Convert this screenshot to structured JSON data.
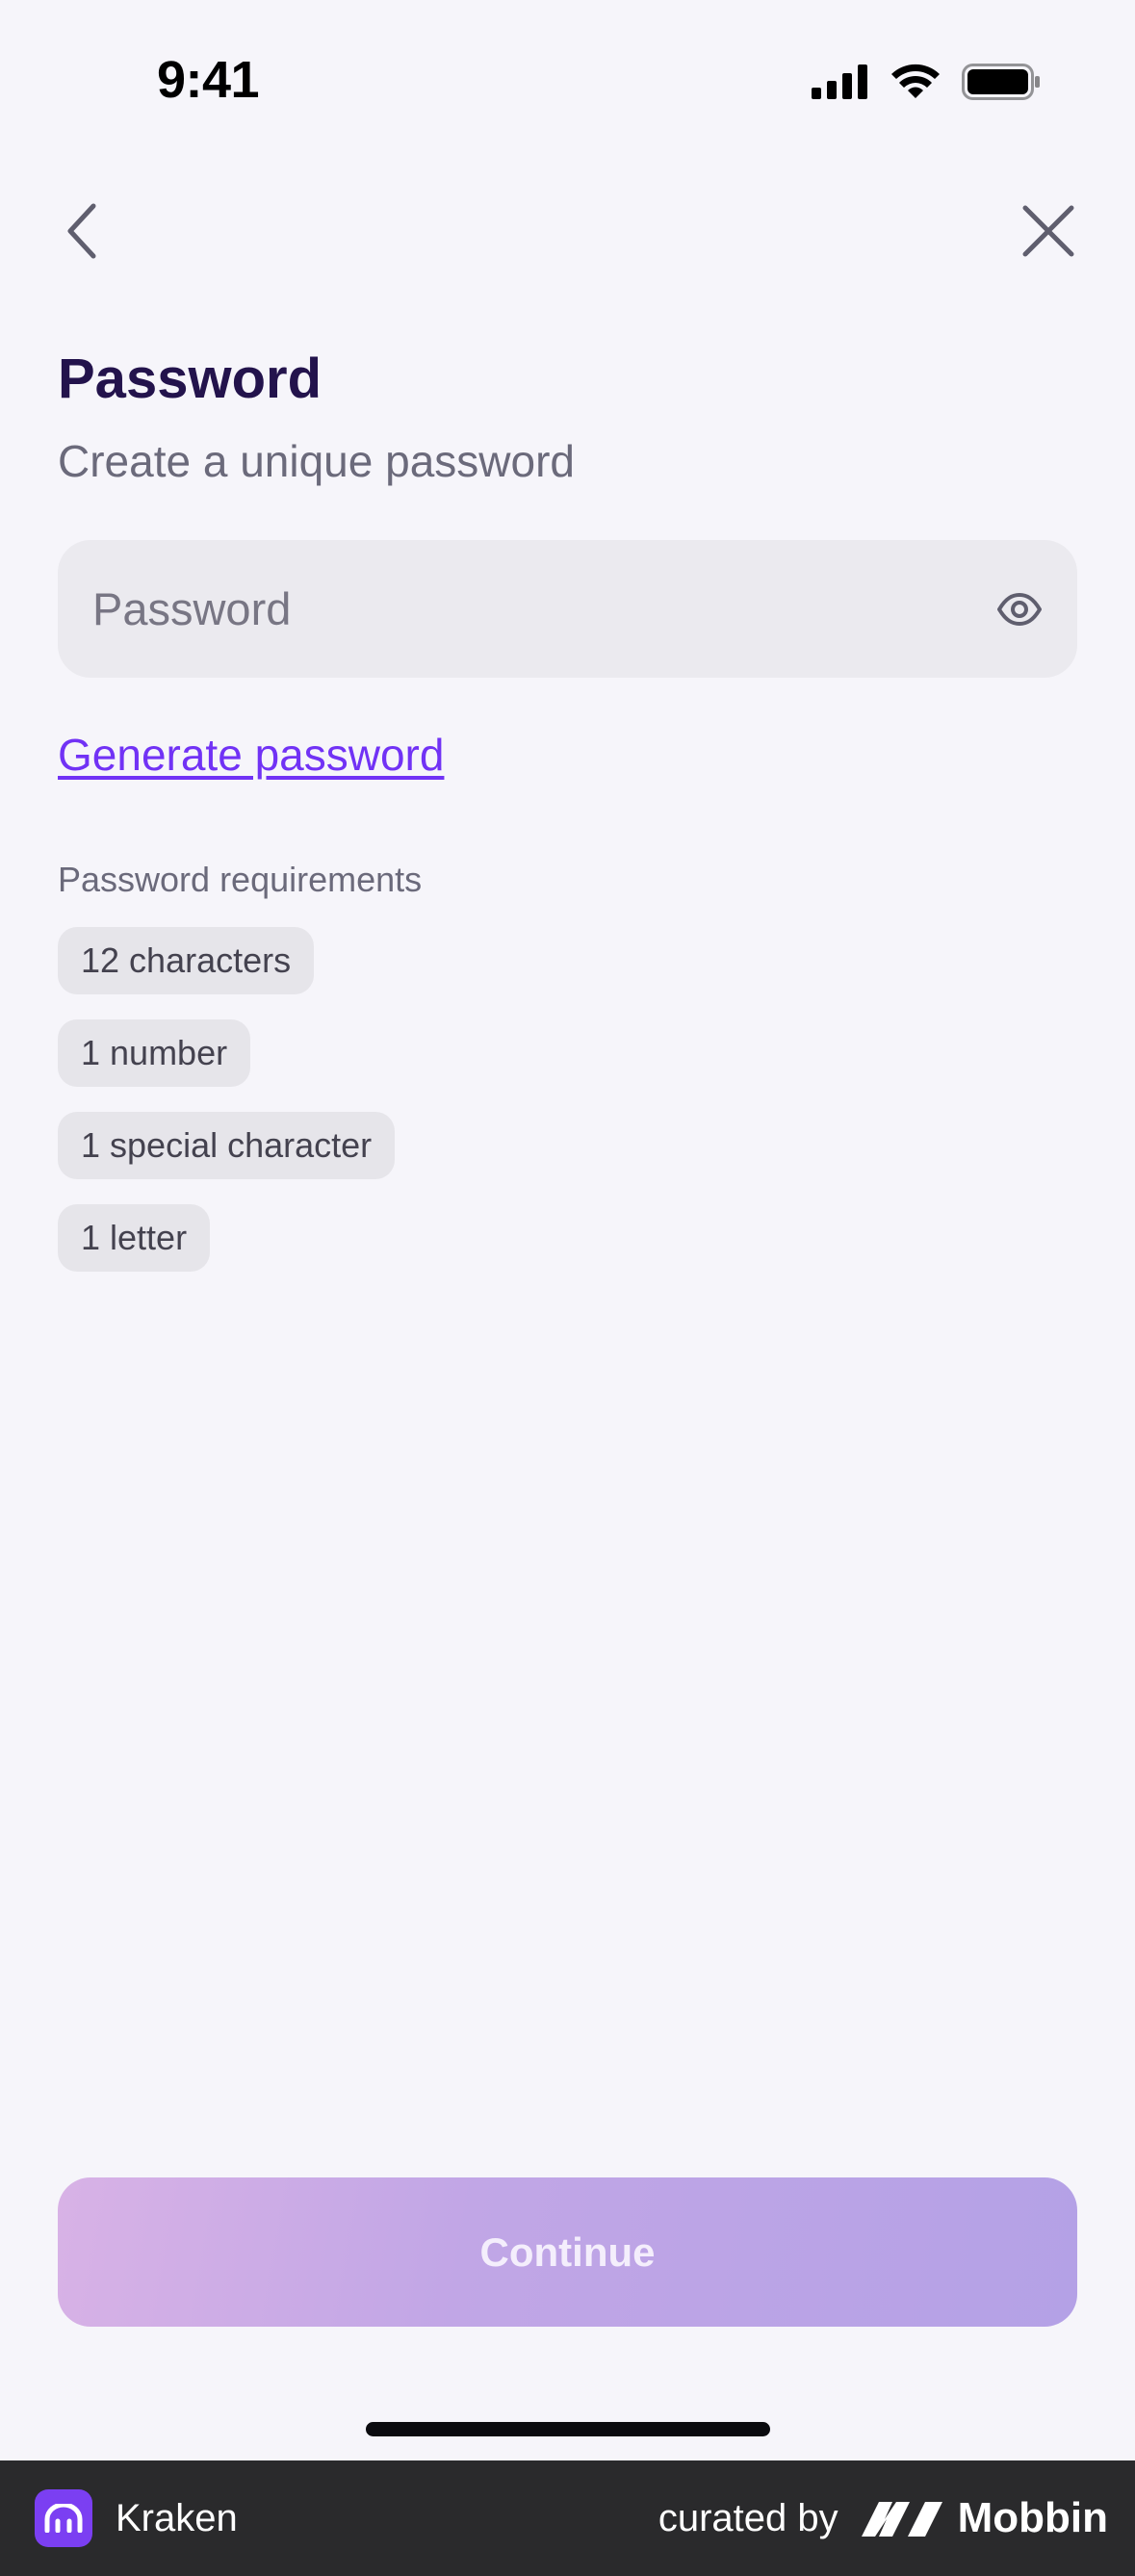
{
  "status_bar": {
    "time": "9:41"
  },
  "screen": {
    "title": "Password",
    "subtitle": "Create a unique password"
  },
  "password_field": {
    "placeholder": "Password",
    "value": ""
  },
  "generate_link": "Generate password",
  "requirements": {
    "label": "Password requirements",
    "items": [
      "12 characters",
      "1 number",
      "1 special character",
      "1 letter"
    ]
  },
  "continue_label": "Continue",
  "footer": {
    "app_name": "Kraken",
    "curated_by": "curated by",
    "brand": "Mobbin"
  },
  "colors": {
    "accent": "#7132f5",
    "title": "#23134c",
    "background": "#f6f5fa"
  }
}
